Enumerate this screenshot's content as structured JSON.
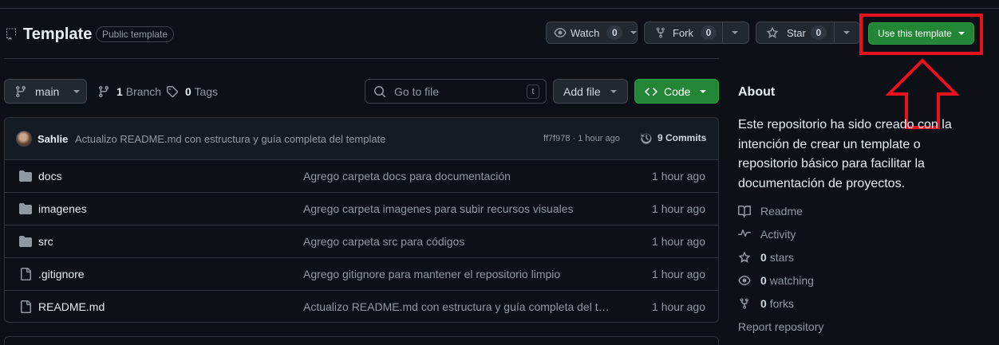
{
  "repo": {
    "name": "Template",
    "badge": "Public template"
  },
  "actions": {
    "watch_label": "Watch",
    "watch_count": "0",
    "fork_label": "Fork",
    "fork_count": "0",
    "star_label": "Star",
    "star_count": "0",
    "use_template_label": "Use this template"
  },
  "toolbar": {
    "branch": "main",
    "branch_count": "1",
    "branch_word": "Branch",
    "tag_count": "0",
    "tag_word": "Tags",
    "go_to_file_placeholder": "Go to file",
    "go_to_file_shortcut": "t",
    "add_file_label": "Add file",
    "code_label": "Code"
  },
  "latest_commit": {
    "author": "Sahlie",
    "message": "Actualizo README.md con estructura y guía completa del template",
    "sha_time": "ff7f978 · 1 hour ago",
    "commits_label": "9 Commits"
  },
  "files": [
    {
      "type": "folder",
      "name": "docs",
      "message": "Agrego carpeta docs para documentación",
      "time": "1 hour ago"
    },
    {
      "type": "folder",
      "name": "imagenes",
      "message": "Agrego carpeta imagenes para subir recursos visuales",
      "time": "1 hour ago"
    },
    {
      "type": "folder",
      "name": "src",
      "message": "Agrego carpeta src para códigos",
      "time": "1 hour ago"
    },
    {
      "type": "file",
      "name": ".gitignore",
      "message": "Agrego gitignore para mantener el repositorio limpio",
      "time": "1 hour ago"
    },
    {
      "type": "file",
      "name": "README.md",
      "message": "Actualizo README.md con estructura y guía completa del template",
      "time": "1 hour ago"
    }
  ],
  "about": {
    "title": "About",
    "description": "Este repositorio ha sido creado con la intención de crear un template o repositorio básico para facilitar la documentación de proyectos.",
    "readme": "Readme",
    "activity": "Activity",
    "stars_count": "0",
    "stars_word": "stars",
    "watching_count": "0",
    "watching_word": "watching",
    "forks_count": "0",
    "forks_word": "forks",
    "report": "Report repository"
  },
  "colors": {
    "background": "#0d1117",
    "primary_green": "#238636",
    "highlight_red": "#e8121c",
    "border": "#30363d"
  },
  "icons": {
    "repo": "repo-template-icon",
    "watch": "eye-icon",
    "fork": "repo-forked-icon",
    "star": "star-icon",
    "branch": "git-branch-icon",
    "tag": "tag-icon",
    "search": "search-icon",
    "code": "code-icon",
    "history": "history-icon",
    "folder": "folder-icon",
    "file": "file-icon",
    "book": "book-icon",
    "pulse": "pulse-icon"
  }
}
